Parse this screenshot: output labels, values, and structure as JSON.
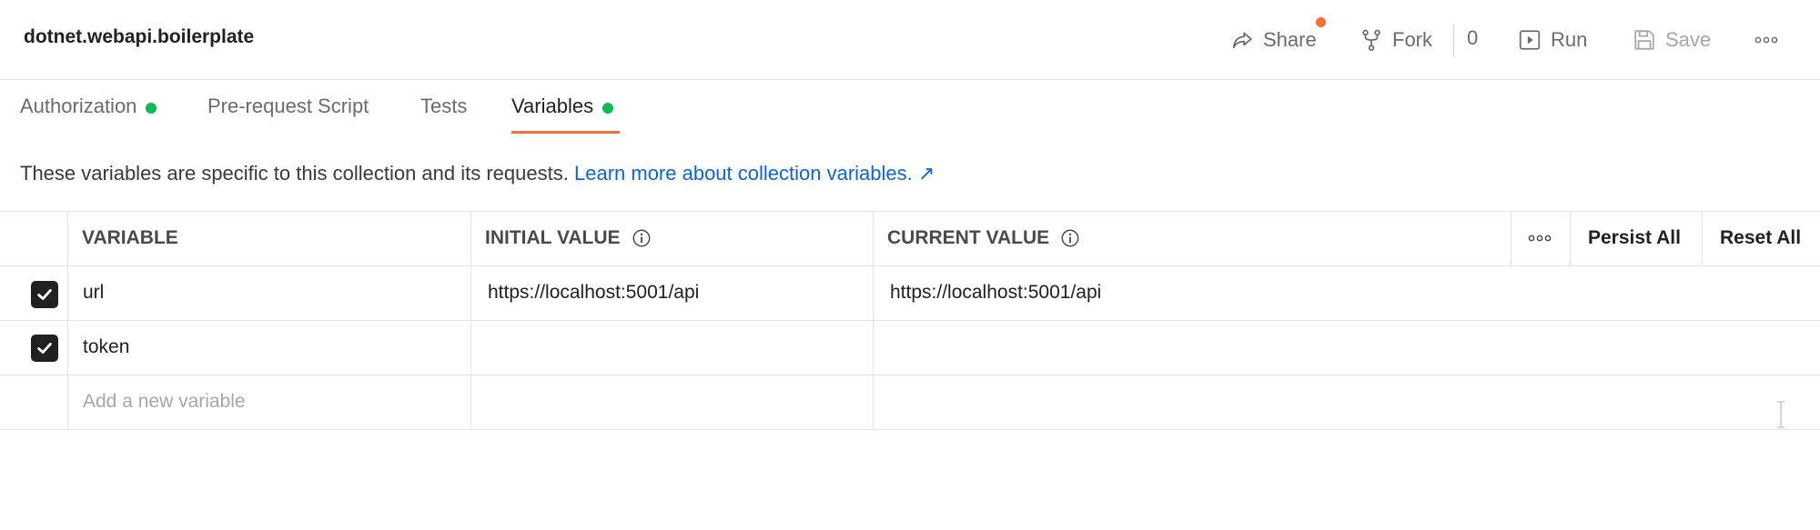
{
  "header": {
    "title": "dotnet.webapi.boilerplate",
    "share_label": "Share",
    "fork_label": "Fork",
    "fork_count": "0",
    "run_label": "Run",
    "save_label": "Save"
  },
  "tabs": [
    {
      "label": "Authorization",
      "dot": true
    },
    {
      "label": "Pre-request Script",
      "dot": false
    },
    {
      "label": "Tests",
      "dot": false
    },
    {
      "label": "Variables",
      "dot": true,
      "active": true
    }
  ],
  "description": {
    "text": "These variables are specific to this collection and its requests.",
    "link": "Learn more about collection variables.",
    "link_arrow": "↗"
  },
  "table": {
    "headers": {
      "variable": "VARIABLE",
      "initial_value": "INITIAL VALUE",
      "current_value": "CURRENT VALUE",
      "persist_all": "Persist All",
      "reset_all": "Reset All"
    },
    "rows": [
      {
        "checked": true,
        "variable": "url",
        "initial_value": "https://localhost:5001/api",
        "current_value": "https://localhost:5001/api"
      },
      {
        "checked": true,
        "variable": "token",
        "initial_value": "",
        "current_value": ""
      }
    ],
    "add_placeholder": "Add a new variable"
  },
  "colors": {
    "accent": "#ff6c37",
    "status_dot": "#0cbb52",
    "link": "#0b64d8"
  }
}
